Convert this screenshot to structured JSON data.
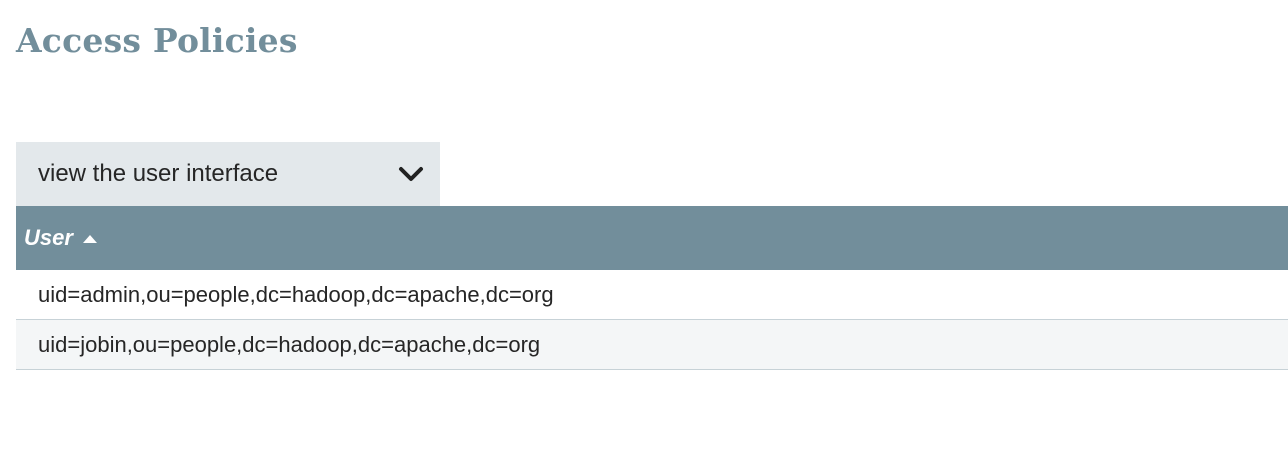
{
  "page": {
    "title": "Access Policies"
  },
  "policy_select": {
    "selected": "view the user interface",
    "icon": "chevron-down-icon"
  },
  "table": {
    "columns": [
      {
        "label": "User",
        "sort": "ascending",
        "sort_icon": "sort-ascending-icon"
      }
    ],
    "rows": [
      {
        "user": "uid=admin,ou=people,dc=hadoop,dc=apache,dc=org"
      },
      {
        "user": "uid=jobin,ou=people,dc=hadoop,dc=apache,dc=org"
      }
    ]
  },
  "colors": {
    "title": "#728e9b",
    "header_bg": "#728e9b",
    "select_bg": "#e3e8eb",
    "row_alt_bg": "#f4f6f7",
    "row_border": "#c7d2d7"
  }
}
